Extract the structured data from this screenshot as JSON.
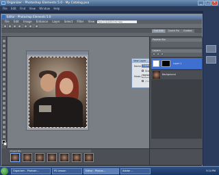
{
  "organizer": {
    "title": "Organizer - Photoshop Elements 5.0 - My Catalog.psa",
    "menu": [
      "File",
      "Edit",
      "Find",
      "View",
      "Window",
      "Help"
    ]
  },
  "editor": {
    "title": "Editor - Photoshop Elements 5.0",
    "menu": [
      "File",
      "Edit",
      "Image",
      "Enhance",
      "Layer",
      "Select",
      "Filter",
      "View",
      "Window",
      "Help"
    ],
    "search_placeholder": "Type a question for help",
    "mode_tabs": [
      "Full Edit",
      "Quick Fix",
      "Guided"
    ]
  },
  "dialog": {
    "title": "New Layer",
    "close": "x",
    "name_label": "Name:",
    "name_value": "Layer 1",
    "clip_label": "Group With Previous Layer",
    "mode_label": "Mode:",
    "mode_value": "Normal",
    "opacity_label": "Opacity:",
    "opacity_value": "100",
    "opacity_unit": "%",
    "fill_label": "(No neutral color exists for Normal mode.)",
    "ok": "OK",
    "cancel": "Cancel"
  },
  "panels": {
    "palette_bin": "Palette Bin",
    "layers": "Layers",
    "layer_top": "Layer 1",
    "layer_bottom": "Background"
  },
  "project_bin": {
    "label": "Project Bin"
  },
  "taskbar": {
    "items": [
      "Organizer - Photosh...",
      "PS Lesson",
      "Editor - Photos...",
      "Adobe ..."
    ],
    "clock": "3:14 PM"
  }
}
